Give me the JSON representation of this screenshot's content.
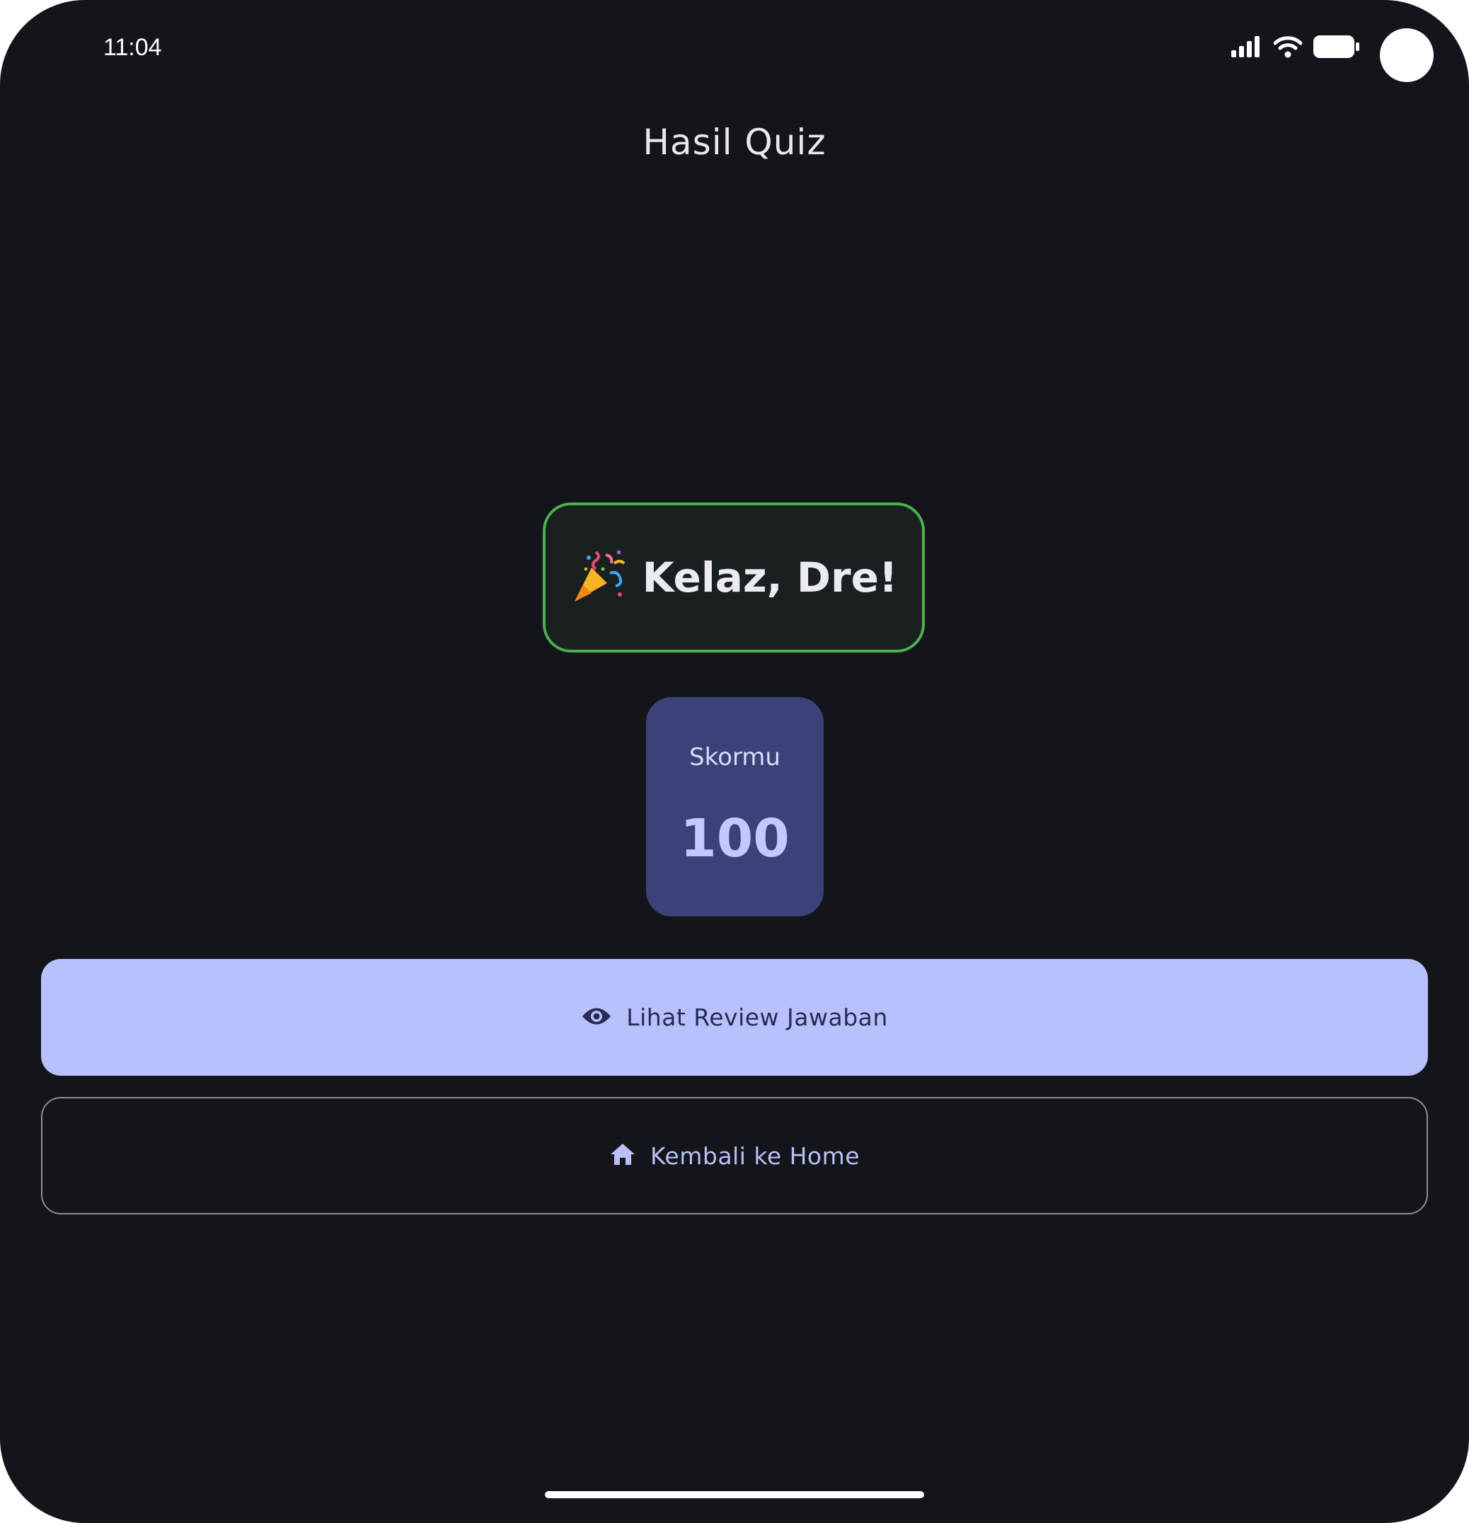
{
  "status_bar": {
    "time": "11:04",
    "icons": [
      "signal-icon",
      "wifi-icon",
      "battery-icon"
    ]
  },
  "header": {
    "title": "Hasil Quiz"
  },
  "result": {
    "emoji": "🎉",
    "emoji_icon": "party-popper-icon",
    "message": "Kelaz, Dre!",
    "border_color": "#4caf50"
  },
  "score": {
    "label": "Skormu",
    "value": "100"
  },
  "actions": {
    "review_label": "Lihat Review Jawaban",
    "review_icon": "eye-icon",
    "home_label": "Kembali ke Home",
    "home_icon": "home-icon"
  },
  "colors": {
    "background": "#13151b",
    "primary": "#b8c1fd",
    "score_card": "#3a4279",
    "success": "#4caf50"
  }
}
